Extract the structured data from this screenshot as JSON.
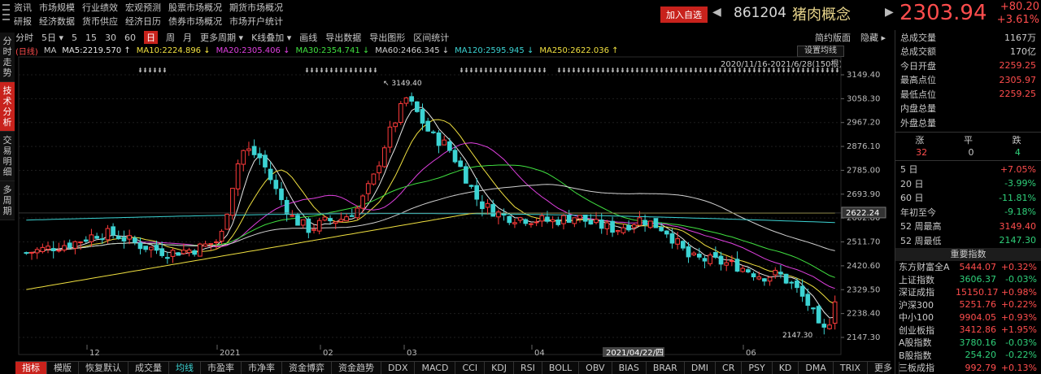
{
  "menu": {
    "row1": [
      "资讯",
      "市场规模",
      "行业绩效",
      "宏观预测",
      "股票市场概况",
      "期货市场概况"
    ],
    "row2": [
      "研报",
      "经济数据",
      "货币供应",
      "经济日历",
      "债券市场概况",
      "市场开户统计"
    ]
  },
  "header": {
    "add_watch": "加入自选",
    "code": "861204",
    "name": "猪肉概念",
    "price": "2303.94",
    "change": "+80.20",
    "change_pct": "+3.61%"
  },
  "left_tabs": [
    {
      "label": "分时走势",
      "active": false
    },
    {
      "label": "技术分析",
      "active": true
    },
    {
      "label": "交易明细",
      "active": false
    },
    {
      "label": "多周期",
      "active": false
    }
  ],
  "toolbar": {
    "items": [
      {
        "label": "分时",
        "active": false
      },
      {
        "label": "5日 ▾",
        "active": false
      },
      {
        "label": "5",
        "active": false
      },
      {
        "label": "15",
        "active": false
      },
      {
        "label": "30",
        "active": false
      },
      {
        "label": "60",
        "active": false
      },
      {
        "label": "日",
        "active": true
      },
      {
        "label": "周",
        "active": false
      },
      {
        "label": "月",
        "active": false
      },
      {
        "label": "更多周期 ▾",
        "active": false
      },
      {
        "label": "K线叠加 ▾",
        "active": false
      },
      {
        "label": "画线",
        "active": false
      },
      {
        "label": "导出数据",
        "active": false
      },
      {
        "label": "导出图形",
        "active": false
      },
      {
        "label": "区间统计",
        "active": false
      }
    ],
    "right": [
      "简约版面",
      "隐藏 ▸"
    ]
  },
  "ma_legend": [
    {
      "label": "(日线)",
      "color": "#ff4d4d"
    },
    {
      "label": "MA",
      "color": "#cccccc"
    },
    {
      "label": "MA5:2219.570 ↑",
      "color": "#e6e6e6"
    },
    {
      "label": "MA10:2224.896 ↓",
      "color": "#f0e040"
    },
    {
      "label": "MA20:2305.406 ↓",
      "color": "#e040e0"
    },
    {
      "label": "MA30:2354.741 ↓",
      "color": "#40e040"
    },
    {
      "label": "MA60:2466.345 ↓",
      "color": "#d0d0d0"
    },
    {
      "label": "MA120:2595.945 ↓",
      "color": "#3cd3d3"
    },
    {
      "label": "MA250:2622.036 ↑",
      "color": "#f0e040"
    }
  ],
  "chart_labels": {
    "set_ma": "设置均线",
    "range": "2020/11/16-2021/6/28(150根)",
    "high_label": "3149.40",
    "low_label": "2147.30",
    "crosshair_value": "2622.24",
    "crosshair_date": "2021/04/22/四"
  },
  "chart_data": {
    "type": "candlestick",
    "y_ticks": [
      3149.4,
      3058.3,
      2967.2,
      2876.1,
      2785.0,
      2693.9,
      2602.8,
      2511.7,
      2420.6,
      2329.5,
      2238.4,
      2147.3
    ],
    "ylim": [
      2130,
      3175
    ],
    "x_labels": [
      "12",
      "2021",
      "02",
      "03",
      "04",
      "06"
    ],
    "count": 150,
    "high": 3149.4,
    "low": 2147.3
  },
  "bottom_tabs": [
    {
      "label": "指标",
      "active": true,
      "cyan": false
    },
    {
      "label": "模版",
      "active": false,
      "cyan": false
    },
    {
      "label": "恢复默认",
      "active": false,
      "cyan": false
    },
    {
      "label": "成交量",
      "active": false,
      "cyan": false
    },
    {
      "label": "均线",
      "active": false,
      "cyan": true
    },
    {
      "label": "市盈率",
      "active": false,
      "cyan": false
    },
    {
      "label": "市净率",
      "active": false,
      "cyan": false
    },
    {
      "label": "资金博弈",
      "active": false,
      "cyan": false
    },
    {
      "label": "资金趋势",
      "active": false,
      "cyan": false
    },
    {
      "label": "DDX",
      "active": false,
      "cyan": false
    },
    {
      "label": "MACD",
      "active": false,
      "cyan": false
    },
    {
      "label": "CCI",
      "active": false,
      "cyan": false
    },
    {
      "label": "KDJ",
      "active": false,
      "cyan": false
    },
    {
      "label": "RSI",
      "active": false,
      "cyan": false
    },
    {
      "label": "BOLL",
      "active": false,
      "cyan": false
    },
    {
      "label": "OBV",
      "active": false,
      "cyan": false
    },
    {
      "label": "BIAS",
      "active": false,
      "cyan": false
    },
    {
      "label": "BRAR",
      "active": false,
      "cyan": false
    },
    {
      "label": "DMI",
      "active": false,
      "cyan": false
    },
    {
      "label": "CR",
      "active": false,
      "cyan": false
    },
    {
      "label": "PSY",
      "active": false,
      "cyan": false
    },
    {
      "label": "KD",
      "active": false,
      "cyan": false
    },
    {
      "label": "DMA",
      "active": false,
      "cyan": false
    },
    {
      "label": "TRIX",
      "active": false,
      "cyan": false
    },
    {
      "label": "更多",
      "active": false,
      "cyan": false
    }
  ],
  "stats": [
    {
      "k": "总成交量",
      "v": "1167万",
      "c": ""
    },
    {
      "k": "总成交额",
      "v": "170亿",
      "c": "cyan"
    },
    {
      "k": "今日开盘",
      "v": "2259.25",
      "c": "red"
    },
    {
      "k": "最高点位",
      "v": "2305.97",
      "c": "red"
    },
    {
      "k": "最低点位",
      "v": "2259.25",
      "c": "red"
    },
    {
      "k": "内盘总量",
      "v": "",
      "c": ""
    },
    {
      "k": "外盘总量",
      "v": "",
      "c": ""
    }
  ],
  "breadth": {
    "labels": [
      "涨",
      "平",
      "跌"
    ],
    "values": [
      "32",
      "0",
      "4"
    ]
  },
  "perf": [
    {
      "k": "5 日",
      "v": "+7.05%",
      "c": "red"
    },
    {
      "k": "20 日",
      "v": "-3.99%",
      "c": "green"
    },
    {
      "k": "60 日",
      "v": "-11.81%",
      "c": "green"
    },
    {
      "k": "年初至今",
      "v": "-9.18%",
      "c": "green"
    },
    {
      "k": "52 周最高",
      "v": "3149.40",
      "c": "red"
    },
    {
      "k": "52 周最低",
      "v": "2147.30",
      "c": "green"
    }
  ],
  "indices_title": "重要指数",
  "indices": [
    {
      "n": "东方财富全A",
      "p": "5444.07",
      "c": "+0.32%",
      "dir": "red"
    },
    {
      "n": "上证指数",
      "p": "3606.37",
      "c": "-0.03%",
      "dir": "green"
    },
    {
      "n": "深证成指",
      "p": "15150.17",
      "c": "+0.98%",
      "dir": "red"
    },
    {
      "n": "沪深300",
      "p": "5251.76",
      "c": "+0.22%",
      "dir": "red"
    },
    {
      "n": "中小100",
      "p": "9904.05",
      "c": "+0.93%",
      "dir": "red"
    },
    {
      "n": "创业板指",
      "p": "3412.86",
      "c": "+1.95%",
      "dir": "red"
    },
    {
      "n": "A股指数",
      "p": "3780.16",
      "c": "-0.03%",
      "dir": "green"
    },
    {
      "n": "B股指数",
      "p": "254.20",
      "c": "-0.22%",
      "dir": "green"
    },
    {
      "n": "三板成指",
      "p": "992.79",
      "c": "+0.13%",
      "dir": "red"
    }
  ]
}
